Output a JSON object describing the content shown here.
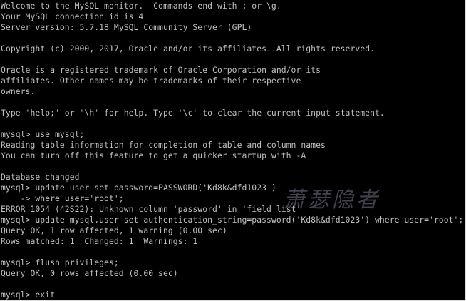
{
  "terminal": {
    "lines": [
      "Welcome to the MySQL monitor.  Commands end with ; or \\g.",
      "Your MySQL connection id is 4",
      "Server version: 5.7.18 MySQL Community Server (GPL)",
      "",
      "Copyright (c) 2000, 2017, Oracle and/or its affiliates. All rights reserved.",
      "",
      "Oracle is a registered trademark of Oracle Corporation and/or its",
      "affiliates. Other names may be trademarks of their respective",
      "owners.",
      "",
      "Type 'help;' or '\\h' for help. Type '\\c' to clear the current input statement.",
      "",
      "mysql> use mysql;",
      "Reading table information for completion of table and column names",
      "You can turn off this feature to get a quicker startup with -A",
      "",
      "Database changed",
      "mysql> update user set password=PASSWORD('Kd8k&dfd1023')",
      "    -> where user='root';",
      "ERROR 1054 (42S22): Unknown column 'password' in 'field list'",
      "mysql> update mysql.user set authentication_string=password('Kd8k&dfd1023') where user='root';",
      "Query OK, 1 row affected, 1 warning (0.00 sec)",
      "Rows matched: 1  Changed: 1  Warnings: 1",
      "",
      "mysql> flush privileges;",
      "Query OK, 0 rows affected (0.00 sec)",
      "",
      "mysql> exit"
    ]
  },
  "watermark": {
    "text": "萧瑟隐者",
    "color": "#787890"
  },
  "colors": {
    "background": "#000000",
    "text": "#c0c0c0"
  }
}
